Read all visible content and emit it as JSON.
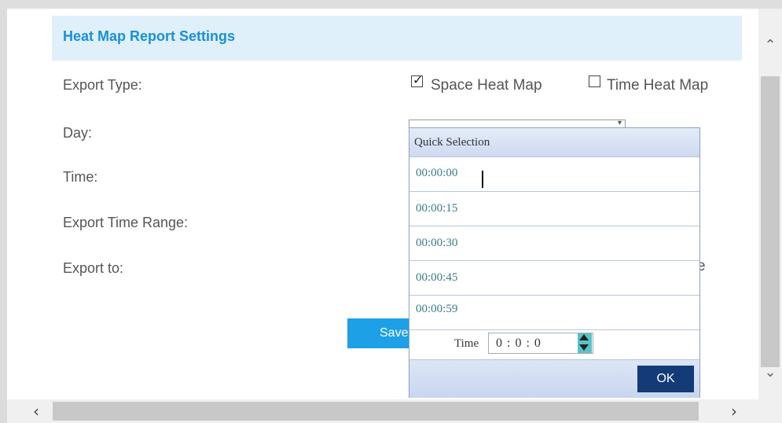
{
  "panel": {
    "title": "Heat Map Report Settings"
  },
  "form": {
    "export_type_label": "Export Type:",
    "space_heat_map_label": "Space Heat Map",
    "time_heat_map_label": "Time Heat Map",
    "space_heat_map_checked": true,
    "time_heat_map_checked": false,
    "day_label": "Day:",
    "time_label": "Time:",
    "export_time_range_label": "Export Time Range:",
    "export_to_label": "Export to:",
    "export_to_partial": "e",
    "save_button_label": "Save"
  },
  "quick_selection": {
    "title": "Quick Selection",
    "items": [
      "00:00:00",
      "00:00:15",
      "00:00:30",
      "00:00:45",
      "00:00:59"
    ],
    "time_label": "Time",
    "time_value": "0 : 0 : 0",
    "ok_label": "OK"
  },
  "icons": {
    "checkbox_checked": "check-icon",
    "scroll_up": "chevron-up-icon",
    "scroll_down": "chevron-down-icon",
    "scroll_left": "chevron-left-icon",
    "scroll_right": "chevron-right-icon"
  },
  "colors": {
    "accent": "#1a8fd8",
    "header_bg": "#dff0fb",
    "save_button": "#1da0e6",
    "ok_button": "#143a78"
  }
}
